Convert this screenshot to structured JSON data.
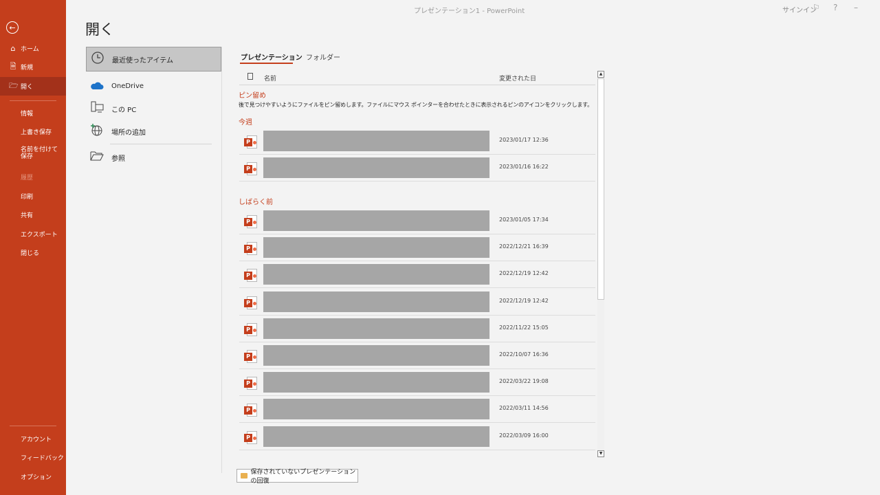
{
  "window": {
    "title": "プレゼンテーション1  -  PowerPoint",
    "signin": "サインイン"
  },
  "sidebar": {
    "back_icon": "back-arrow-icon",
    "top_items": [
      {
        "label": "ホーム",
        "icon": "home-icon"
      },
      {
        "label": "新規",
        "icon": "new-document-icon"
      },
      {
        "label": "開く",
        "icon": "open-folder-icon",
        "selected": true
      }
    ],
    "middle_items": [
      {
        "label": "情報"
      },
      {
        "label": "上書き保存"
      },
      {
        "label": "名前を付けて保存"
      },
      {
        "label": "履歴",
        "disabled": true
      },
      {
        "label": "印刷"
      },
      {
        "label": "共有"
      },
      {
        "label": "エクスポート"
      },
      {
        "label": "閉じる"
      }
    ],
    "bottom_items": [
      {
        "label": "アカウント"
      },
      {
        "label": "フィードバック"
      },
      {
        "label": "オプション"
      }
    ],
    "accent_color": "#c43e1c"
  },
  "page": {
    "title": "開く"
  },
  "locations": [
    {
      "label": "最近使ったアイテム",
      "icon": "clock-icon",
      "selected": true
    },
    {
      "label": "OneDrive",
      "icon": "cloud-icon"
    },
    {
      "label": "この PC",
      "icon": "computer-icon"
    },
    {
      "label": "場所の追加",
      "icon": "globe-add-icon"
    },
    {
      "label": "参照",
      "icon": "folder-icon"
    }
  ],
  "tabs": [
    {
      "label": "プレゼンテーション",
      "active": true
    },
    {
      "label": "フォルダー",
      "active": false
    }
  ],
  "list": {
    "col_name": "名前",
    "col_date": "変更された日",
    "pinned_label": "ピン留め",
    "pinned_desc": "後で見つけやすいようにファイルをピン留めします。ファイルにマウス ポインターを合わせたときに表示されるピンのアイコンをクリックします。",
    "this_week_label": "今週",
    "older_label": "しばらく前",
    "this_week_files": [
      {
        "date": "2023/01/17 12:36"
      },
      {
        "date": "2023/01/16 16:22"
      }
    ],
    "older_files": [
      {
        "date": "2023/01/05 17:34"
      },
      {
        "date": "2022/12/21 16:39"
      },
      {
        "date": "2022/12/19 12:42"
      },
      {
        "date": "2022/12/19 12:42"
      },
      {
        "date": "2022/11/22 15:05"
      },
      {
        "date": "2022/10/07 16:36"
      },
      {
        "date": "2022/03/22 19:08"
      },
      {
        "date": "2022/03/11 14:56"
      },
      {
        "date": "2022/03/09 16:00"
      }
    ]
  },
  "recover_button": {
    "label": "保存されていないプレゼンテーションの回復",
    "icon": "folder-icon"
  }
}
